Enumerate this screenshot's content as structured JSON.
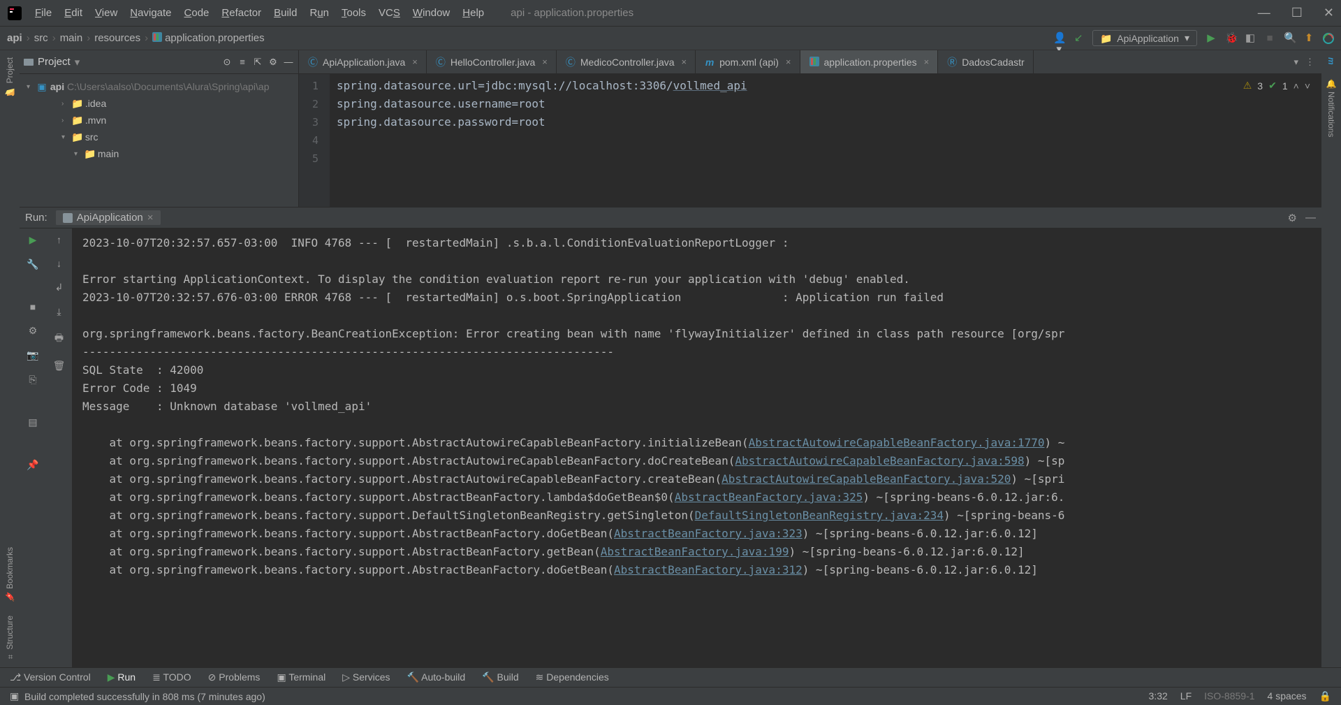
{
  "title_path": "api - application.properties",
  "menu": [
    "File",
    "Edit",
    "View",
    "Navigate",
    "Code",
    "Refactor",
    "Build",
    "Run",
    "Tools",
    "VCS",
    "Window",
    "Help"
  ],
  "breadcrumbs": [
    "api",
    "src",
    "main",
    "resources",
    "application.properties"
  ],
  "run_config": "ApiApplication",
  "project": {
    "label": "Project",
    "root_name": "api",
    "root_path": "C:\\Users\\aalso\\Documents\\Alura\\Spring\\api\\ap",
    "items": [
      ".idea",
      ".mvn",
      "src",
      "main"
    ]
  },
  "tabs": [
    {
      "label": "ApiApplication.java"
    },
    {
      "label": "HelloController.java"
    },
    {
      "label": "MedicoController.java"
    },
    {
      "label": "pom.xml (api)"
    },
    {
      "label": "application.properties",
      "active": true
    },
    {
      "label": "DadosCadastr"
    }
  ],
  "editor": {
    "lines": {
      "1": {
        "prefix": "spring.datasource.url=",
        "mid": "jdbc:mysql://localhost:3306/",
        "link": "vollmed_api"
      },
      "2": "spring.datasource.username=root",
      "3": "spring.datasource.password=root",
      "4": "",
      "5": ""
    },
    "annot_warn": "3",
    "annot_ok": "1"
  },
  "run": {
    "label": "Run:",
    "tab": "ApiApplication",
    "lines": [
      "2023-10-07T20:32:57.657-03:00  INFO 4768 --- [  restartedMain] .s.b.a.l.ConditionEvaluationReportLogger :",
      "",
      "Error starting ApplicationContext. To display the condition evaluation report re-run your application with 'debug' enabled.",
      "2023-10-07T20:32:57.676-03:00 ERROR 4768 --- [  restartedMain] o.s.boot.SpringApplication               : Application run failed",
      "",
      "org.springframework.beans.factory.BeanCreationException: Error creating bean with name 'flywayInitializer' defined in class path resource [org/spr",
      "-------------------------------------------------------------------------------",
      "SQL State  : 42000",
      "Error Code : 1049",
      "Message    : Unknown database 'vollmed_api'",
      ""
    ],
    "trace": [
      {
        "pre": "    at org.springframework.beans.factory.support.AbstractAutowireCapableBeanFactory.initializeBean(",
        "link": "AbstractAutowireCapableBeanFactory.java:1770",
        "post": ") ~"
      },
      {
        "pre": "    at org.springframework.beans.factory.support.AbstractAutowireCapableBeanFactory.doCreateBean(",
        "link": "AbstractAutowireCapableBeanFactory.java:598",
        "post": ") ~[sp"
      },
      {
        "pre": "    at org.springframework.beans.factory.support.AbstractAutowireCapableBeanFactory.createBean(",
        "link": "AbstractAutowireCapableBeanFactory.java:520",
        "post": ") ~[spri"
      },
      {
        "pre": "    at org.springframework.beans.factory.support.AbstractBeanFactory.lambda$doGetBean$0(",
        "link": "AbstractBeanFactory.java:325",
        "post": ") ~[spring-beans-6.0.12.jar:6."
      },
      {
        "pre": "    at org.springframework.beans.factory.support.DefaultSingletonBeanRegistry.getSingleton(",
        "link": "DefaultSingletonBeanRegistry.java:234",
        "post": ") ~[spring-beans-6"
      },
      {
        "pre": "    at org.springframework.beans.factory.support.AbstractBeanFactory.doGetBean(",
        "link": "AbstractBeanFactory.java:323",
        "post": ") ~[spring-beans-6.0.12.jar:6.0.12]"
      },
      {
        "pre": "    at org.springframework.beans.factory.support.AbstractBeanFactory.getBean(",
        "link": "AbstractBeanFactory.java:199",
        "post": ") ~[spring-beans-6.0.12.jar:6.0.12]"
      },
      {
        "pre": "    at org.springframework.beans.factory.support.AbstractBeanFactory.doGetBean(",
        "link": "AbstractBeanFactory.java:312",
        "post": ") ~[spring-beans-6.0.12.jar:6.0.12]"
      }
    ]
  },
  "bottom_tools": [
    "Version Control",
    "Run",
    "TODO",
    "Problems",
    "Terminal",
    "Services",
    "Auto-build",
    "Build",
    "Dependencies"
  ],
  "status_msg": "Build completed successfully in 808 ms (7 minutes ago)",
  "status_right": {
    "pos": "3:32",
    "lf": "LF",
    "enc": "ISO-8859-1",
    "indent": "4 spaces"
  }
}
